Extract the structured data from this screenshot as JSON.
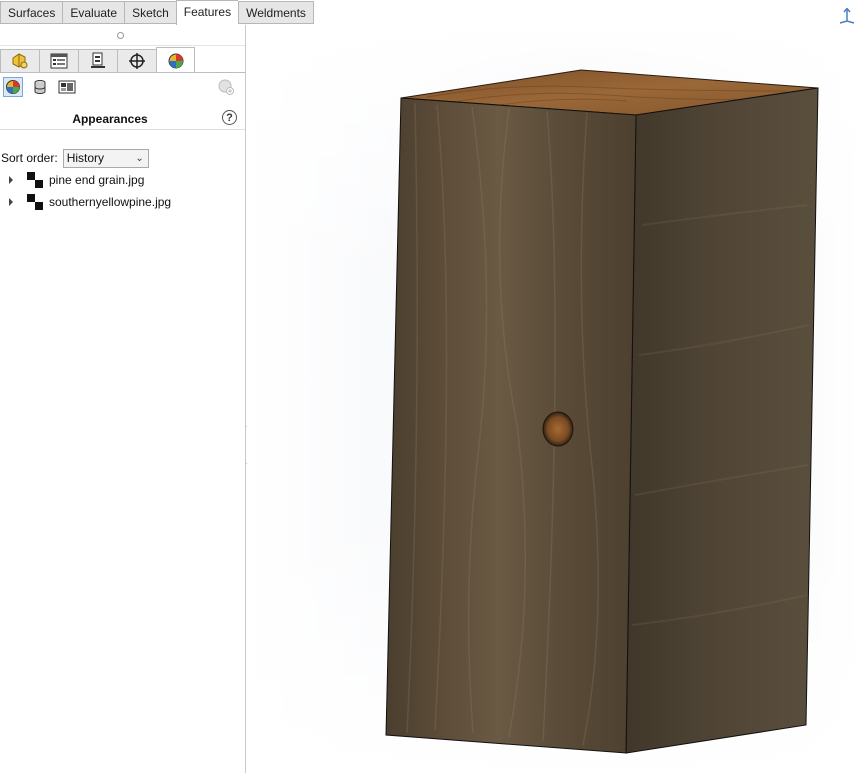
{
  "command_tabs": [
    "Surfaces",
    "Evaluate",
    "Sketch",
    "Features",
    "Weldments"
  ],
  "active_command_tab": "Features",
  "manager_tabs": [
    {
      "name": "feature-manager",
      "icon": "feature-tree-icon"
    },
    {
      "name": "property-manager",
      "icon": "property-manager-icon"
    },
    {
      "name": "configuration-manager",
      "icon": "configuration-manager-icon"
    },
    {
      "name": "dimxpert-manager",
      "icon": "dimxpert-crosshair-icon"
    },
    {
      "name": "display-manager",
      "icon": "appearance-ball-icon",
      "active": true
    }
  ],
  "subtools": [
    "appearances-icon",
    "scene-icon",
    "decals-icon"
  ],
  "panel": {
    "title": "Appearances",
    "help": "?",
    "sort_label": "Sort order:",
    "sort_value": "History",
    "items": [
      {
        "label": "pine end grain.jpg"
      },
      {
        "label": "southernyellowpine.jpg"
      }
    ]
  },
  "colors": {
    "wood_front": "#5a4a36",
    "wood_side": "#4e4434",
    "wood_top": "#8a5a2e",
    "accent_selected": "#dbe9f7"
  }
}
